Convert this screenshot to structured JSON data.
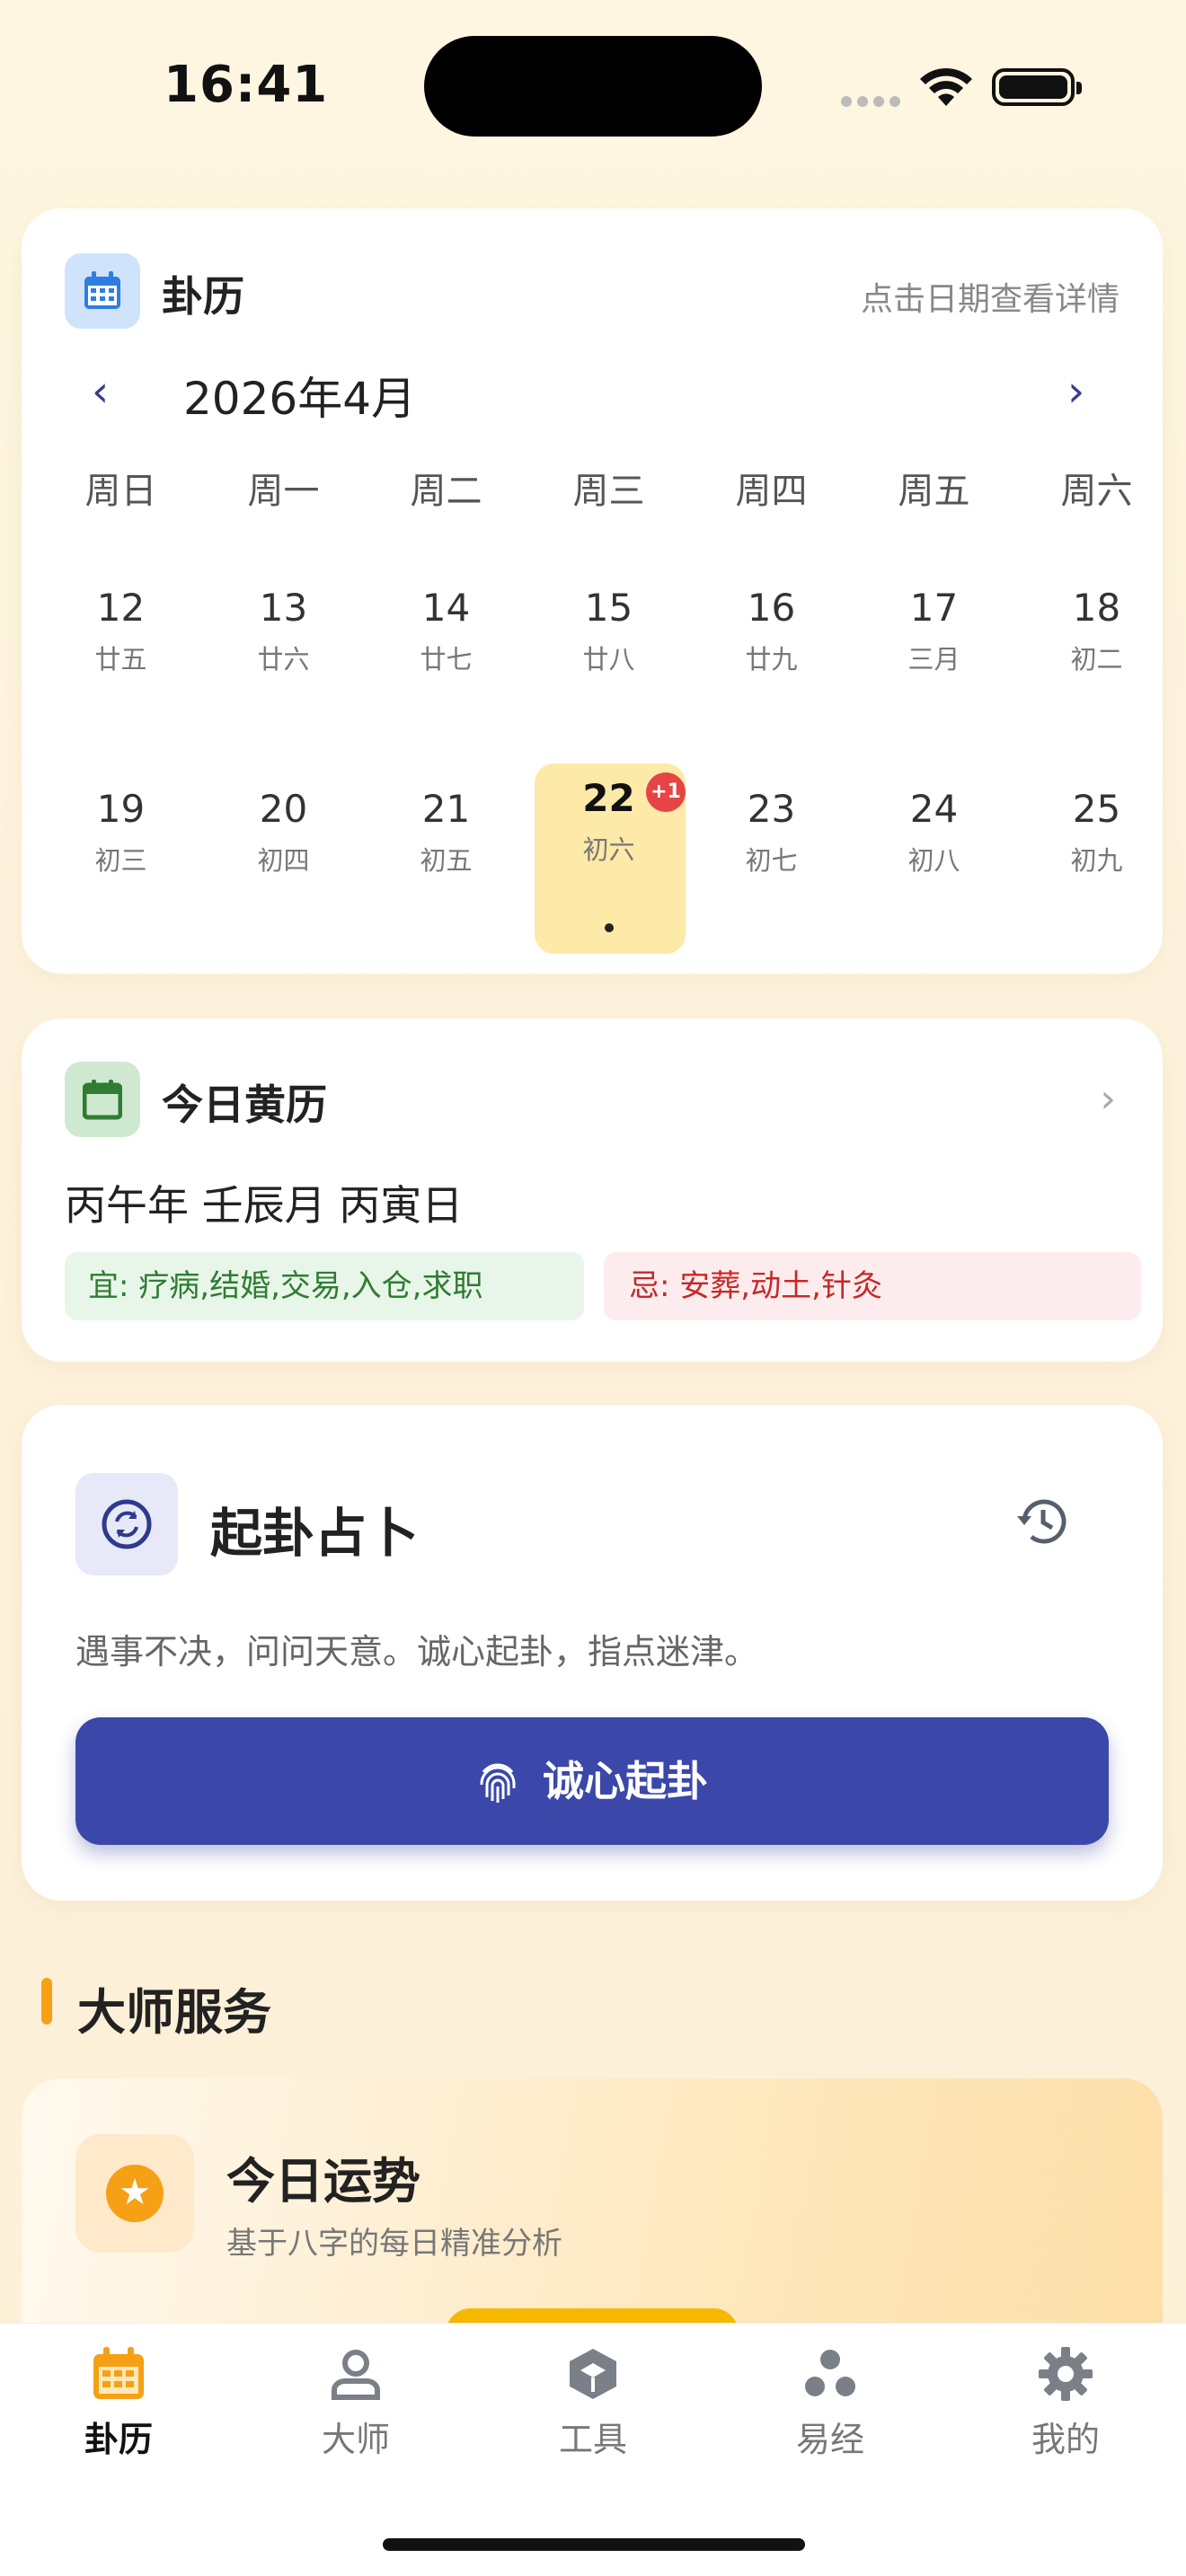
{
  "status": {
    "time": "16:41"
  },
  "calendar": {
    "title": "卦历",
    "hint": "点击日期查看详情",
    "month": "2026年4月",
    "prev": "‹",
    "next": "›",
    "weekdays": [
      "周日",
      "周一",
      "周二",
      "周三",
      "周四",
      "周五",
      "周六"
    ],
    "weeks": [
      [
        {
          "day": "12",
          "lunar": "廿五"
        },
        {
          "day": "13",
          "lunar": "廿六"
        },
        {
          "day": "14",
          "lunar": "廿七"
        },
        {
          "day": "15",
          "lunar": "廿八"
        },
        {
          "day": "16",
          "lunar": "廿九"
        },
        {
          "day": "17",
          "lunar": "三月"
        },
        {
          "day": "18",
          "lunar": "初二"
        }
      ],
      [
        {
          "day": "19",
          "lunar": "初三"
        },
        {
          "day": "20",
          "lunar": "初四"
        },
        {
          "day": "21",
          "lunar": "初五"
        },
        {
          "day": "22",
          "lunar": "初六"
        },
        {
          "day": "23",
          "lunar": "初七"
        },
        {
          "day": "24",
          "lunar": "初八"
        },
        {
          "day": "25",
          "lunar": "初九"
        }
      ]
    ],
    "today_badge": "+1"
  },
  "almanac": {
    "title": "今日黄历",
    "ganzhi": "丙午年 壬辰月 丙寅日",
    "yi": "宜: 疗病,结婚,交易,入仓,求职",
    "ji": "忌: 安葬,动土,针灸"
  },
  "divination": {
    "title": "起卦占卜",
    "desc": "遇事不决，问问天意。诚心起卦，指点迷津。",
    "button": "诚心起卦"
  },
  "services": {
    "section_title": "大师服务",
    "fortune_title": "今日运势",
    "fortune_sub": "基于八字的每日精准分析"
  },
  "tabs": [
    {
      "label": "卦历",
      "icon": "calendar-icon"
    },
    {
      "label": "大师",
      "icon": "person-icon"
    },
    {
      "label": "工具",
      "icon": "cube-icon"
    },
    {
      "label": "易经",
      "icon": "three-dots-icon"
    },
    {
      "label": "我的",
      "icon": "gear-icon"
    }
  ],
  "colors": {
    "accent": "#3B48A9",
    "today_bg": "#FDE9A8",
    "tab_active": "#F5A015",
    "yi_text": "#2E7D32",
    "ji_text": "#C62828"
  }
}
